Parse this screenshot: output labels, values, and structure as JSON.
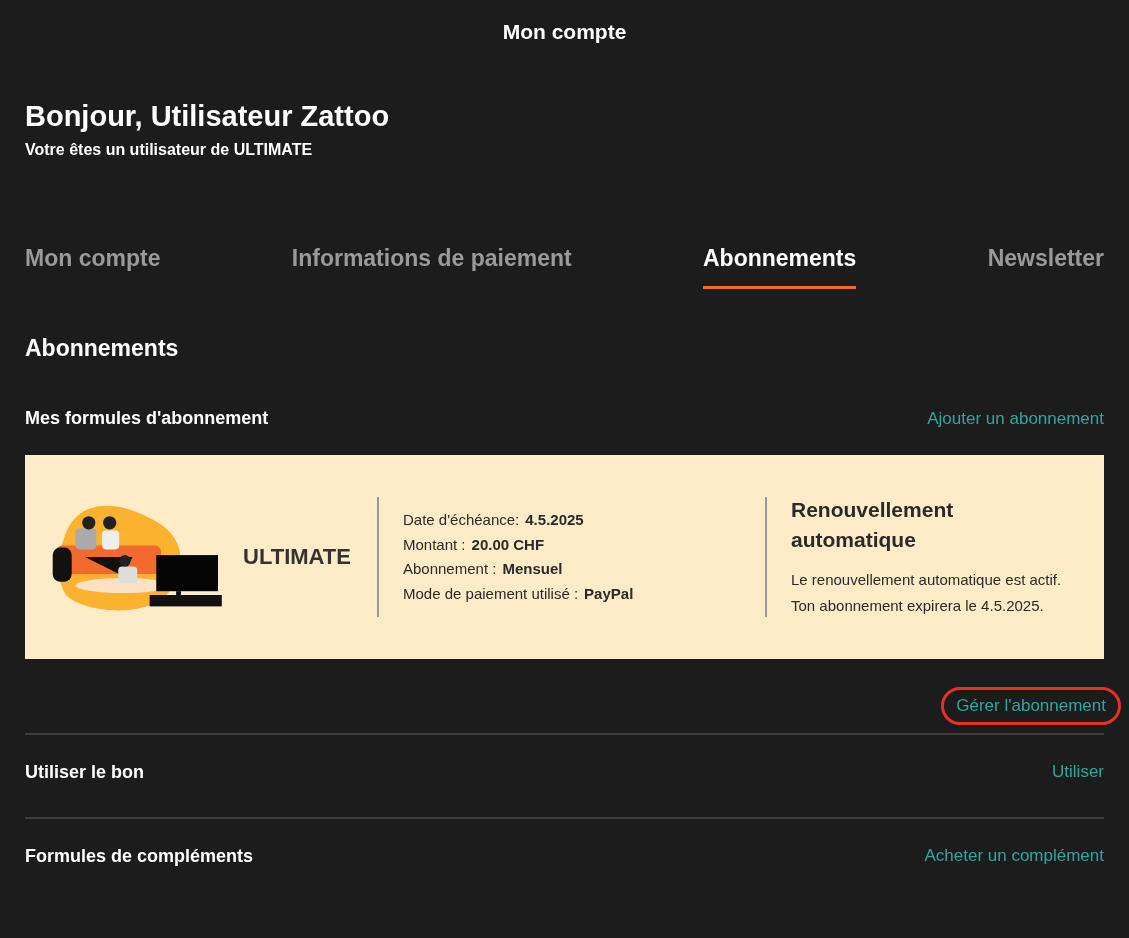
{
  "header": {
    "title": "Mon compte"
  },
  "greeting": {
    "title": "Bonjour, Utilisateur Zattoo",
    "subtitle": "Votre êtes un utilisateur de ULTIMATE"
  },
  "tabs": [
    {
      "label": "Mon compte",
      "selected": false
    },
    {
      "label": "Informations de paiement",
      "selected": false
    },
    {
      "label": "Abonnements",
      "selected": true
    },
    {
      "label": "Newsletter",
      "selected": false
    }
  ],
  "section": {
    "title": "Abonnements"
  },
  "subscriptions": {
    "title": "Mes formules d'abonnement",
    "action": "Ajouter un abonnement",
    "card": {
      "plan": "ULTIMATE",
      "details": [
        {
          "label": "Date d'échéance:",
          "value": "4.5.2025"
        },
        {
          "label": "Montant :",
          "value": "20.00 CHF"
        },
        {
          "label": "Abonnement :",
          "value": "Mensuel"
        },
        {
          "label": "Mode de paiement utilisé :",
          "value": "PayPal"
        }
      ],
      "renewal": {
        "title": "Renouvellement automatique",
        "text": "Le renouvellement automatique est actif. Ton abonnement expirera le 4.5.2025."
      }
    },
    "manage": {
      "label": "Gérer l'abonnement",
      "highlighted": true
    }
  },
  "rows": [
    {
      "title": "Utiliser le bon",
      "action": "Utiliser"
    },
    {
      "title": "Formules de compléments",
      "action": "Acheter un complément"
    }
  ]
}
